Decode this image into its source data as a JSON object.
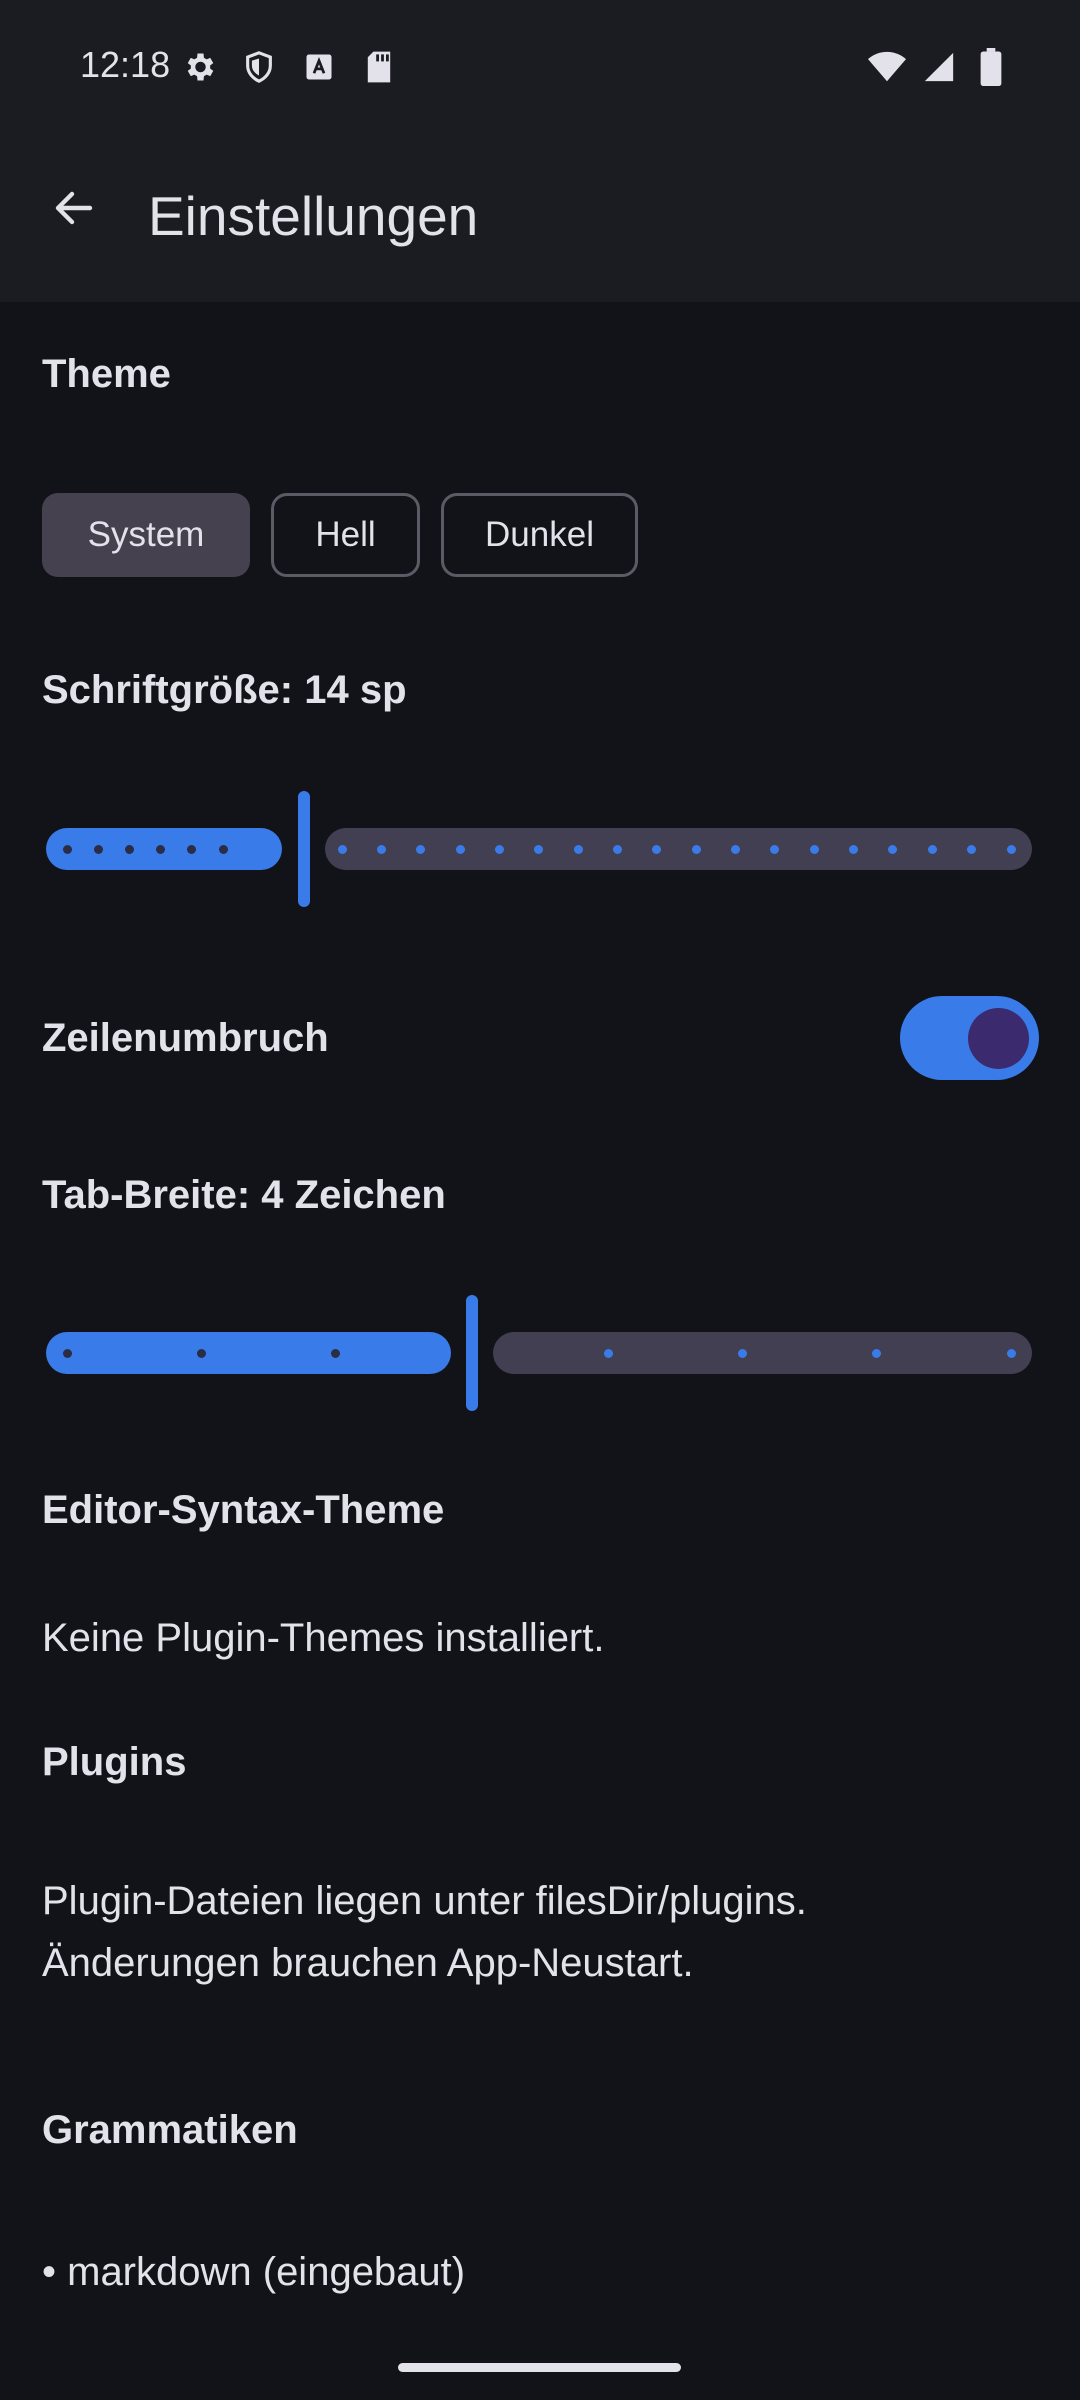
{
  "status_bar": {
    "time": "12:18",
    "left_icons": [
      "gear-icon",
      "shield-icon",
      "font-a-icon",
      "sd-card-icon"
    ],
    "right_icons": [
      "wifi-icon",
      "signal-icon",
      "battery-icon"
    ]
  },
  "app_bar": {
    "back_icon": "arrow-left-icon",
    "title": "Einstellungen"
  },
  "theme": {
    "label": "Theme",
    "options": [
      "System",
      "Hell",
      "Dunkel"
    ],
    "selected": "System"
  },
  "font_size": {
    "label": "Schriftgröße: 14 sp",
    "value": 14,
    "steps_before": 6,
    "steps_after": 18
  },
  "line_wrap": {
    "label": "Zeilenumbruch",
    "enabled": true
  },
  "tab_width": {
    "label": "Tab-Breite: 4 Zeichen",
    "value": 4,
    "steps_before": 3,
    "steps_after": 4
  },
  "editor_theme": {
    "label": "Editor-Syntax-Theme",
    "text": "Keine Plugin-Themes installiert."
  },
  "plugins": {
    "label": "Plugins",
    "line1": "Plugin-Dateien liegen unter filesDir/plugins.",
    "line2": "Änderungen brauchen App-Neustart."
  },
  "grammars": {
    "label": "Grammatiken",
    "items": [
      "• markdown (eingebaut)"
    ]
  },
  "colors": {
    "accent": "#3A7BEA",
    "background": "#121318",
    "surface": "#1B1C21"
  }
}
